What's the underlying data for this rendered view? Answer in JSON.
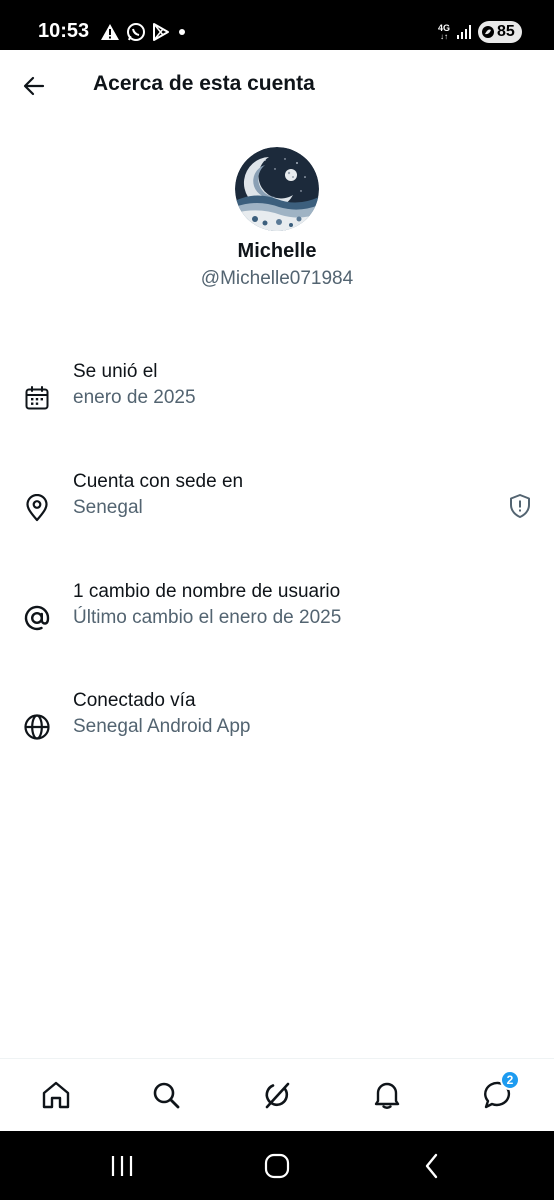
{
  "status_bar": {
    "time": "10:53",
    "icons_left": [
      "warning-icon",
      "whatsapp-icon",
      "play-store-icon",
      "dot-icon"
    ],
    "network": "4G",
    "battery": "85"
  },
  "header": {
    "title": "Acerca de esta cuenta",
    "back_icon": "back-arrow-icon"
  },
  "profile": {
    "name": "Michelle",
    "handle": "@Michelle071984"
  },
  "info_rows": [
    {
      "icon": "calendar-icon",
      "title": "Se unió el",
      "subtitle": "enero de 2025"
    },
    {
      "icon": "location-pin-icon",
      "title": "Cuenta con sede en",
      "subtitle": "Senegal",
      "trailing_icon": "shield-icon"
    },
    {
      "icon": "at-icon",
      "title": "1 cambio de nombre de usuario",
      "subtitle": "Último cambio el enero de 2025"
    },
    {
      "icon": "globe-icon",
      "title": "Conectado vía",
      "subtitle": "Senegal Android App"
    }
  ],
  "bottom_nav": {
    "items": [
      "home-icon",
      "search-icon",
      "grok-icon",
      "bell-icon",
      "messages-icon"
    ],
    "messages_badge": "2"
  },
  "colors": {
    "primary_text": "#0f1419",
    "secondary_text": "#536471",
    "accent": "#1d9bf0"
  }
}
